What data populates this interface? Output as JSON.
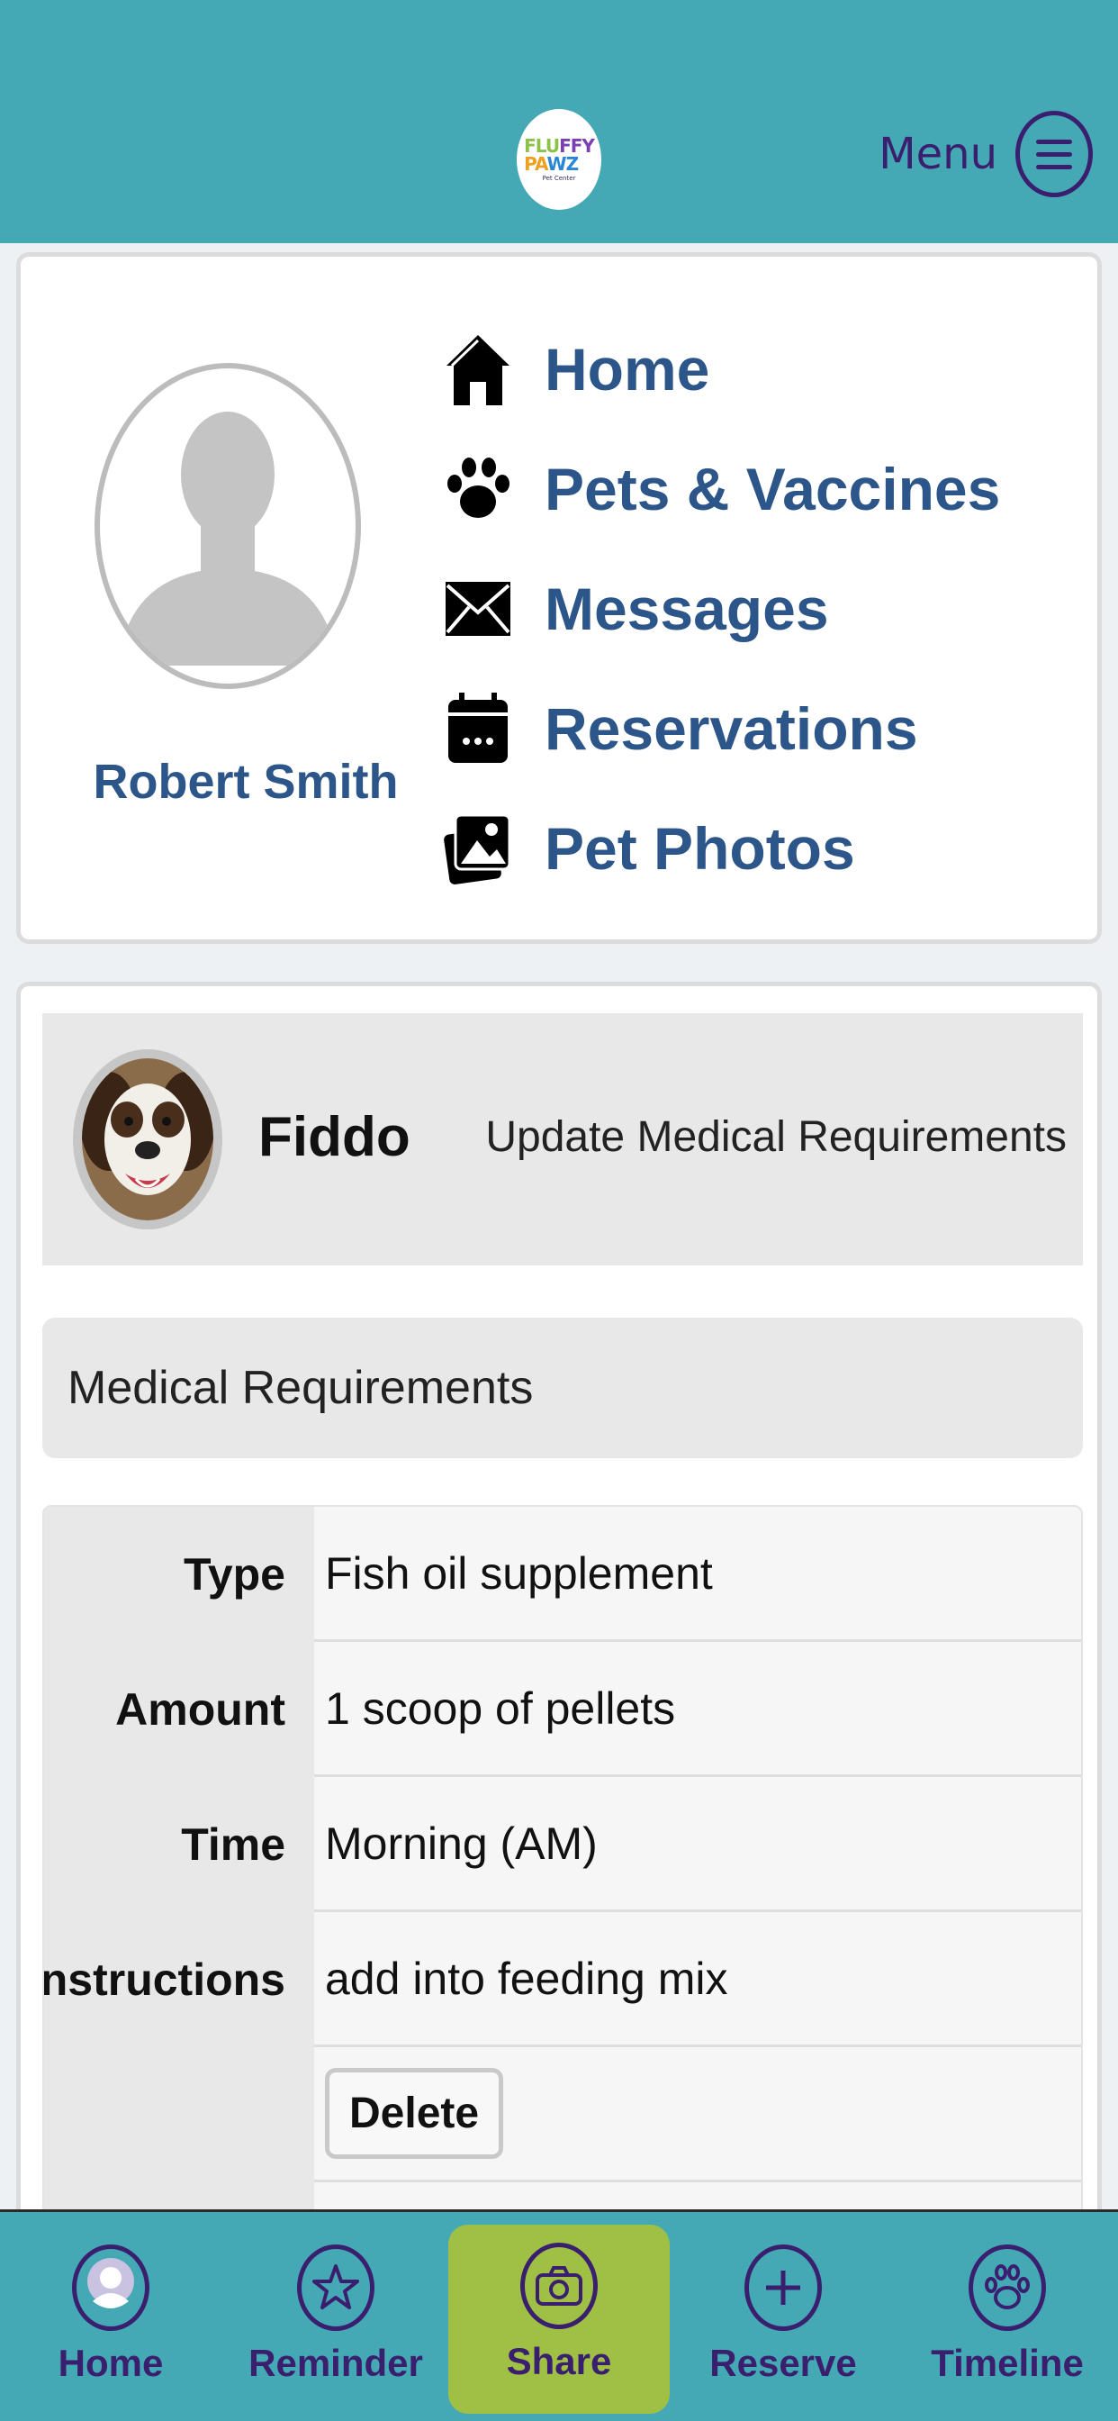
{
  "header": {
    "logo_text": [
      "FLU",
      "FFY",
      "PA",
      "WZ"
    ],
    "logo_sub": "Pet Center",
    "menu_label": "Menu"
  },
  "profile": {
    "name": "Robert Smith"
  },
  "nav": {
    "items": [
      {
        "label": "Home",
        "icon": "home-icon"
      },
      {
        "label": "Pets & Vaccines",
        "icon": "paw-icon"
      },
      {
        "label": "Messages",
        "icon": "envelope-icon"
      },
      {
        "label": "Reservations",
        "icon": "calendar-icon"
      },
      {
        "label": "Pet Photos",
        "icon": "photos-icon"
      }
    ]
  },
  "pet": {
    "name": "Fiddo",
    "update_link": "Update Medical Requirements",
    "section_title": "Medical Requirements",
    "requirements": [
      {
        "label": "Type",
        "value": "Fish oil supplement"
      },
      {
        "label": "Amount",
        "value": "1 scoop of pellets"
      },
      {
        "label": "Time",
        "value": "Morning (AM)"
      },
      {
        "label": "Instructions",
        "value": "add into feeding mix"
      }
    ],
    "delete_label": "Delete"
  },
  "tabbar": {
    "tabs": [
      {
        "label": "Home",
        "icon": "user-icon"
      },
      {
        "label": "Reminder",
        "icon": "star-icon"
      },
      {
        "label": "Share",
        "icon": "camera-icon",
        "active": true
      },
      {
        "label": "Reserve",
        "icon": "plus-icon"
      },
      {
        "label": "Timeline",
        "icon": "paw-icon"
      }
    ]
  },
  "colors": {
    "header_bg": "#45a9b5",
    "accent_purple": "#3a1f6e",
    "nav_blue": "#2c5589",
    "share_green": "#9fc045"
  }
}
